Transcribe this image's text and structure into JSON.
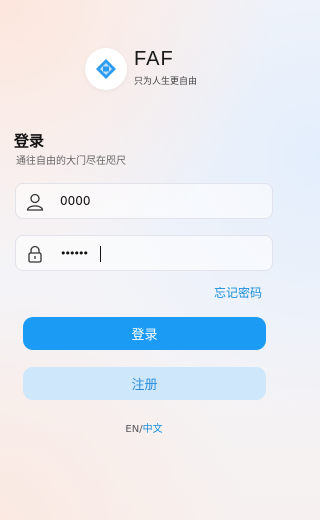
{
  "brand": {
    "name": "FAF",
    "tagline": "只为人生更自由"
  },
  "login": {
    "title": "登录",
    "subtitle": "通往自由的大门尽在咫尺"
  },
  "form": {
    "username": {
      "value": "0000",
      "icon": "user-icon"
    },
    "password": {
      "value": "••••••",
      "icon": "lock-icon"
    },
    "forgot_label": "忘记密码"
  },
  "buttons": {
    "login_label": "登录",
    "register_label": "注册"
  },
  "language": {
    "en": "EN",
    "separator": "/",
    "zh": "中文"
  },
  "colors": {
    "primary": "#1c9bf5",
    "secondary_bg": "#cfe7fb",
    "link": "#1a8fd8"
  }
}
